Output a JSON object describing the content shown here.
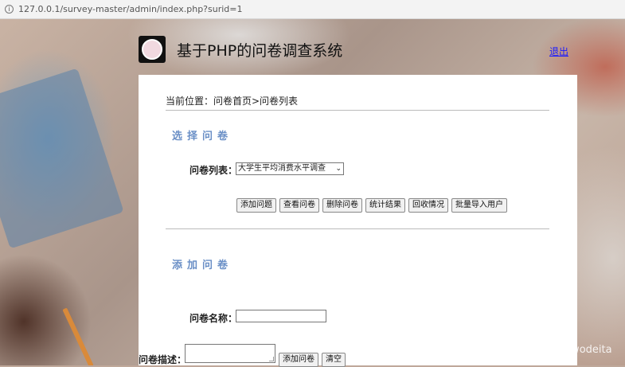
{
  "browser": {
    "url": "127.0.0.1/survey-master/admin/index.php?surid=1"
  },
  "header": {
    "title": "基于PHP的问卷调查系统",
    "logout_label": "退出"
  },
  "breadcrumb": "当前位置：问卷首页>问卷列表",
  "select_section": {
    "title": "选择问卷",
    "list_label": "问卷列表：",
    "selected_survey": "大学生平均消费水平调查",
    "buttons": [
      "添加问题",
      "查看问卷",
      "删除问卷",
      "统计结果",
      "回收情况",
      "批量导入用户"
    ]
  },
  "add_section": {
    "title": "添加问卷",
    "name_label": "问卷名称：",
    "desc_label": "问卷描述：",
    "add_button": "添加问卷",
    "clear_button": "清空"
  },
  "watermark": "https://blog.csdn.net/wodeita"
}
